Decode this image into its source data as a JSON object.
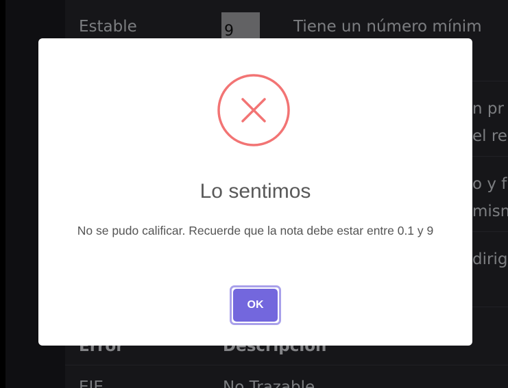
{
  "background": {
    "rows": [
      {
        "col1": "Estable",
        "grade": "9",
        "col3": "Tiene un número mínim"
      },
      {
        "col3a": "n pr",
        "col3b": "el re"
      },
      {
        "col3a": "o y f",
        "col3b": "mism"
      },
      {
        "col3a": "dirig"
      }
    ],
    "header": {
      "col1": "Error",
      "col2": "Descripción"
    },
    "last_row": {
      "col1": "EIE",
      "col2": "No Trazable"
    }
  },
  "modal": {
    "icon": "error-x-circle-icon",
    "title": "Lo sentimos",
    "message": "No se pudo calificar. Recuerde que la nota debe estar entre 0.1 y 9",
    "ok_label": "OK"
  },
  "colors": {
    "accent": "#7367dd",
    "error_icon": "#f27474",
    "overlay": "rgba(0,0,0,0.42)"
  }
}
